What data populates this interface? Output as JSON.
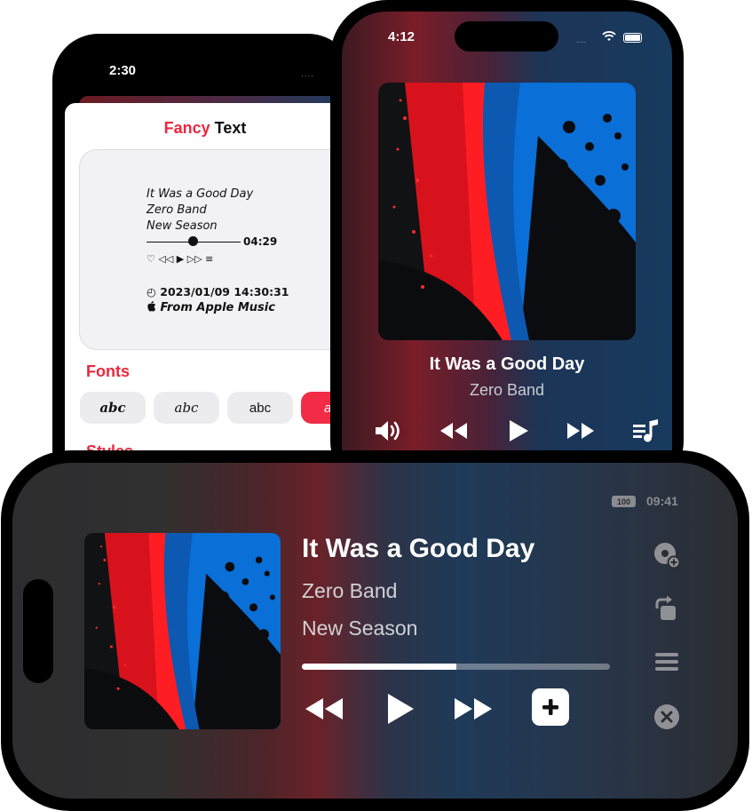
{
  "phone_fancy": {
    "status_time": "2:30",
    "status_dots": "....",
    "title_red": "Fancy",
    "title_black": "Text",
    "preview": {
      "line1": "It Was a Good Day",
      "line2": "Zero Band",
      "line3": "New Season",
      "duration": "04:29",
      "controls": "♡ ◁◁ ▶ ▷▷ ≡",
      "datetime": "◴ 2023/01/09 14:30:31",
      "source": " From Apple Music"
    },
    "fonts_heading": "Fonts",
    "font_chips": [
      "abc",
      "abc",
      "abc",
      "a"
    ],
    "styles_heading": "Styles"
  },
  "phone_player": {
    "status_time": "4:12",
    "status_dots": "....",
    "song_title": "It Was a Good Day",
    "artist": "Zero Band"
  },
  "standby": {
    "battery": "100",
    "clock": "09:41",
    "song_title": "It Was a Good Day",
    "artist": "Zero Band",
    "album": "New Season",
    "progress": 0.5
  },
  "icons": [
    "speaker-icon",
    "rewind-icon",
    "play-icon",
    "fast-forward-icon",
    "lyrics-queue-icon",
    "add-icon",
    "cast-icon",
    "share-icon",
    "menu-icon",
    "close-icon",
    "apple-logo-icon",
    "clock-icon"
  ],
  "colors": {
    "accent_red": "#e8283f",
    "active_chip": "#f22b46"
  }
}
